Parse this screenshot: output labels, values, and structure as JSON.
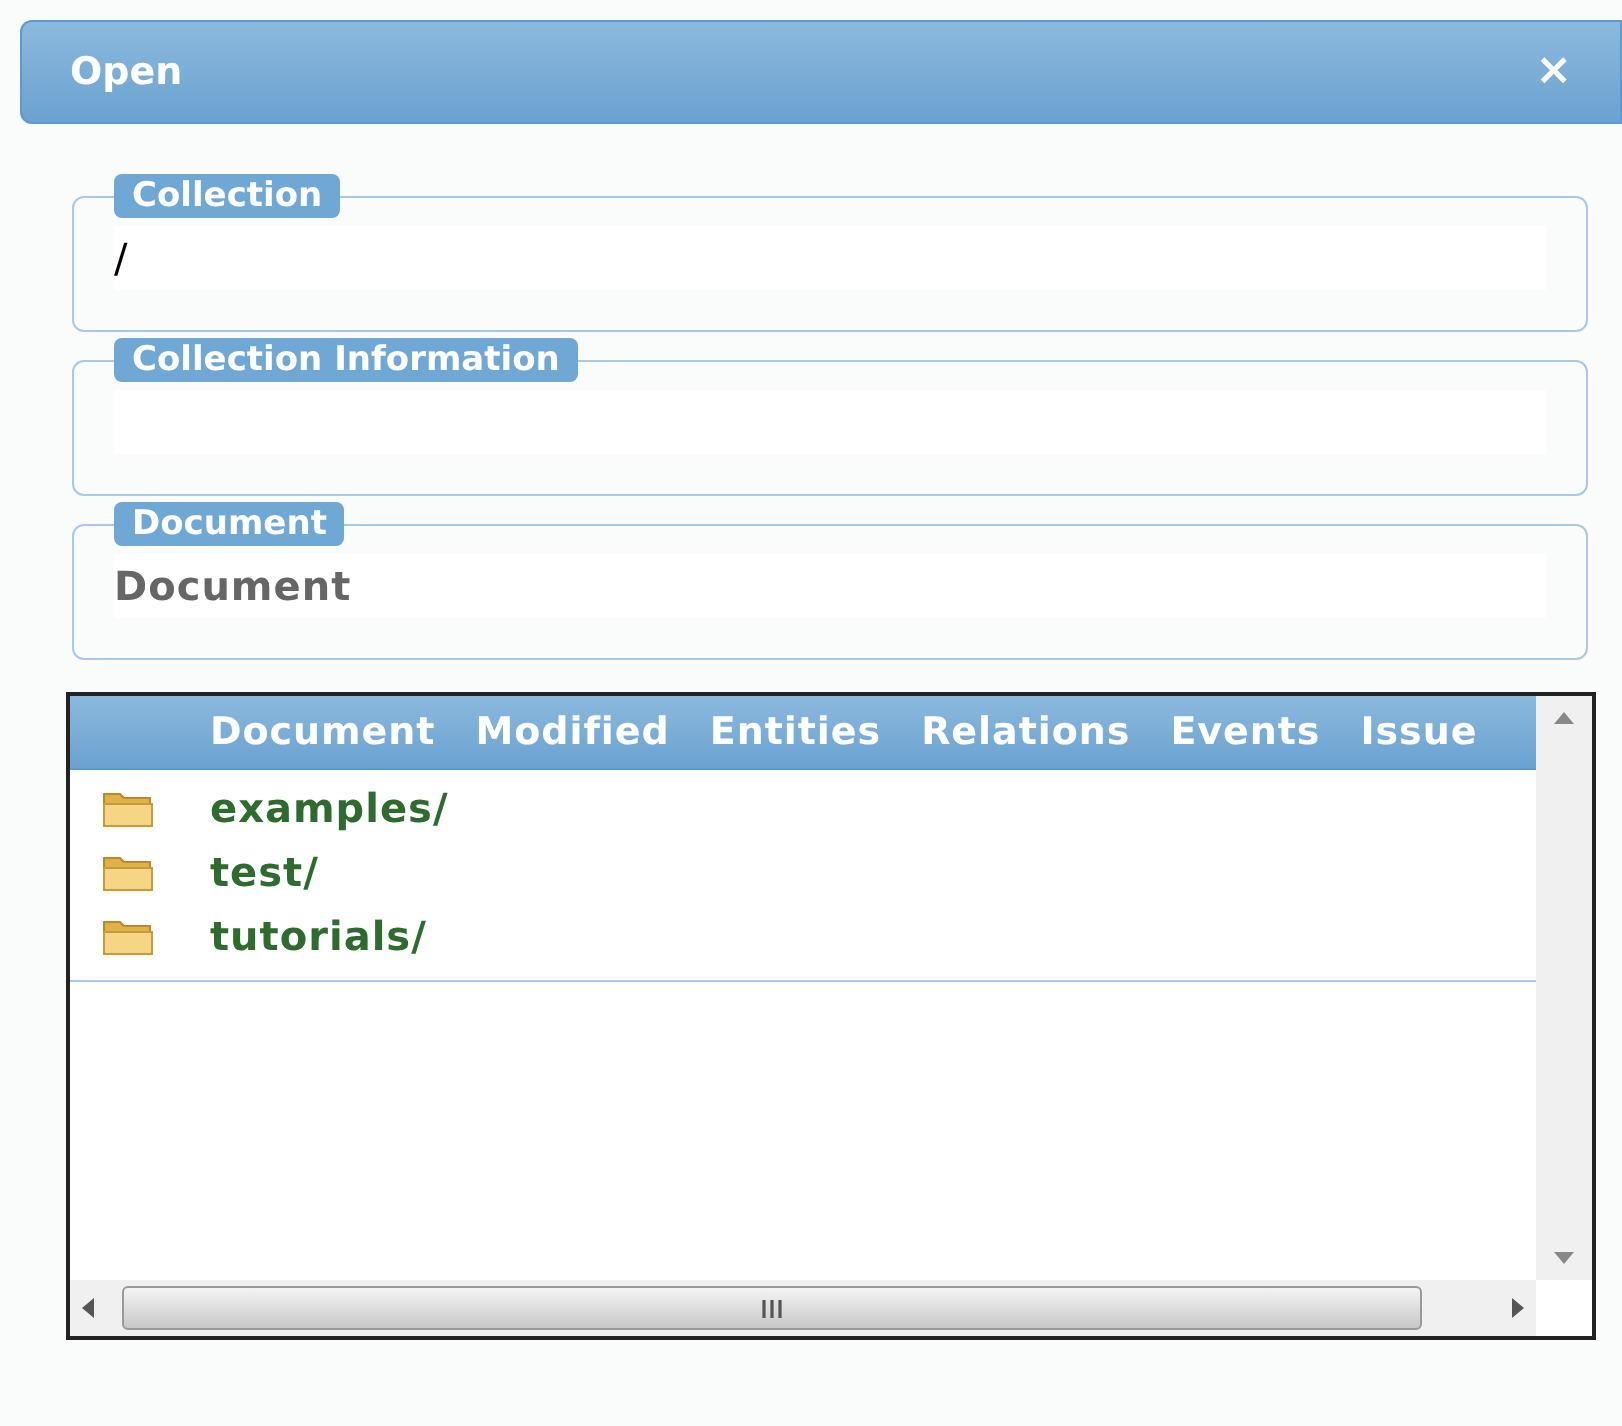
{
  "window": {
    "title": "Open",
    "close": "×"
  },
  "fields": [
    {
      "legend": "Collection",
      "value": "/"
    },
    {
      "legend": "Collection Information"
    },
    {
      "legend": "Document",
      "placeholder": "Document"
    }
  ],
  "table": {
    "columns": [
      "Document",
      "Modified",
      "Entities",
      "Relations",
      "Events",
      "Issue"
    ],
    "rows": [
      {
        "name": "examples/",
        "kind": "folder"
      },
      {
        "name": "test/",
        "kind": "folder"
      },
      {
        "name": "tutorials/",
        "kind": "folder"
      }
    ]
  }
}
